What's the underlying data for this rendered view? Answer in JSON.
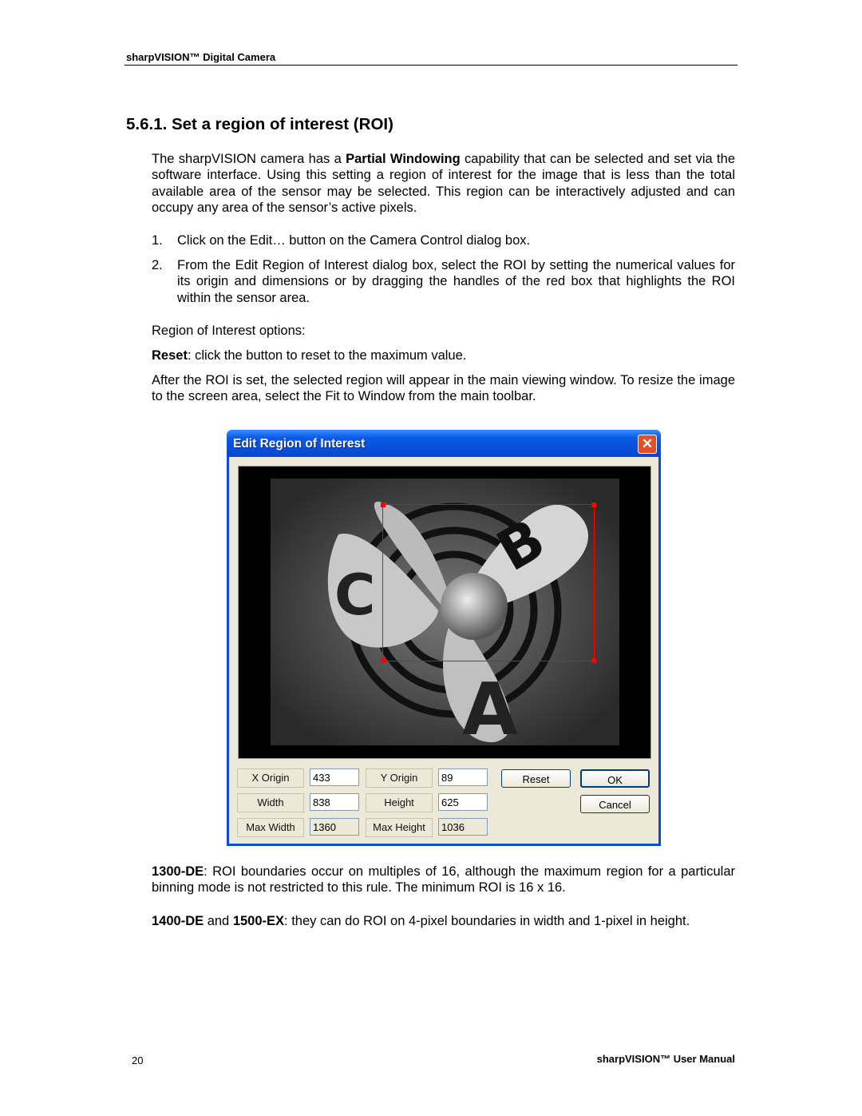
{
  "header": {
    "running_title": "sharpVISION™ Digital Camera"
  },
  "section": {
    "title": "5.6.1.  Set a region of interest (ROI)"
  },
  "body": {
    "intro": {
      "before": "The sharpVISION camera has a ",
      "bold": "Partial Windowing",
      "after": " capability that can be selected and set via the software interface. Using this setting a region of interest for the image that is less than the total available area of the sensor may be selected. This region can be interactively adjusted and can occupy any area of the sensor’s active pixels."
    },
    "steps": [
      {
        "num": "1.",
        "text": "Click on the Edit… button on the Camera Control dialog box."
      },
      {
        "num": "2.",
        "text": "From the Edit Region of Interest dialog box, select the ROI by setting the numerical values for its origin and dimensions or by dragging the handles of the red box that highlights the ROI within the sensor area."
      }
    ],
    "options_label": "Region of Interest options:",
    "reset": {
      "bold": "Reset",
      "text": ": click the button to reset to the maximum value."
    },
    "after_roi": "After the ROI is set, the selected region will appear in the main viewing window. To resize the image to the screen area, select the Fit to Window from the main toolbar.",
    "note1": {
      "bold": "1300-DE",
      "text": ": ROI boundaries occur on multiples of 16, although the maximum region for a particular binning mode is not restricted to this rule. The minimum ROI is 16 x 16."
    },
    "note2": {
      "bold1": "1400-DE",
      "mid": " and ",
      "bold2": "1500-EX",
      "text": ": they can do ROI on 4-pixel boundaries in width and 1-pixel in height."
    }
  },
  "dialog": {
    "title": "Edit Region of Interest",
    "fields": {
      "x_origin_label": "X Origin",
      "x_origin": "433",
      "y_origin_label": "Y Origin",
      "y_origin": "89",
      "width_label": "Width",
      "width": "838",
      "height_label": "Height",
      "height": "625",
      "max_width_label": "Max Width",
      "max_width": "1360",
      "max_height_label": "Max Height",
      "max_height": "1036"
    },
    "buttons": {
      "reset": "Reset",
      "ok": "OK",
      "cancel": "Cancel"
    },
    "colors": {
      "roi_box": "#ff0000",
      "title_bar": "#0b5ae6"
    }
  },
  "footer": {
    "page_number": "20",
    "manual_title": "sharpVISION™ User Manual"
  }
}
